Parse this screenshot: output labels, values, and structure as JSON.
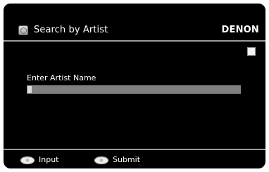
{
  "header": {
    "title": "Search by Artist",
    "brand": "DENON"
  },
  "form": {
    "label": "Enter Artist Name",
    "input_value": ""
  },
  "footer": {
    "items": [
      {
        "label": "Input",
        "icon": "remote-button-icon"
      },
      {
        "label": "Submit",
        "icon": "remote-button-icon"
      }
    ]
  }
}
